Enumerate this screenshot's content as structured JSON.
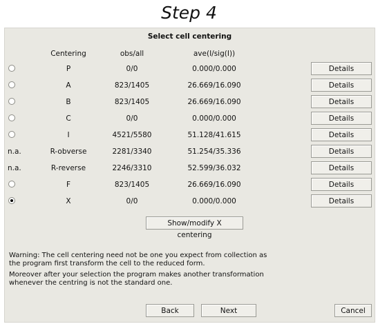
{
  "step_title": "Step 4",
  "panel_title": "Select cell centering",
  "headers": {
    "centering": "Centering",
    "obs_all": "obs/all",
    "ave": "ave(I/sig(I))"
  },
  "rows": [
    {
      "select": "radio",
      "checked": false,
      "label": "",
      "centering": "P",
      "obs_all": "0/0",
      "ave": "0.000/0.000",
      "button": "Details"
    },
    {
      "select": "radio",
      "checked": false,
      "label": "",
      "centering": "A",
      "obs_all": "823/1405",
      "ave": "26.669/16.090",
      "button": "Details"
    },
    {
      "select": "radio",
      "checked": false,
      "label": "",
      "centering": "B",
      "obs_all": "823/1405",
      "ave": "26.669/16.090",
      "button": "Details"
    },
    {
      "select": "radio",
      "checked": false,
      "label": "",
      "centering": "C",
      "obs_all": "0/0",
      "ave": "0.000/0.000",
      "button": "Details"
    },
    {
      "select": "radio",
      "checked": false,
      "label": "",
      "centering": "I",
      "obs_all": "4521/5580",
      "ave": "51.128/41.615",
      "button": "Details"
    },
    {
      "select": "text",
      "checked": false,
      "label": "n.a.",
      "centering": "R-obverse",
      "obs_all": "2281/3340",
      "ave": "51.254/35.336",
      "button": "Details"
    },
    {
      "select": "text",
      "checked": false,
      "label": "n.a.",
      "centering": "R-reverse",
      "obs_all": "2246/3310",
      "ave": "52.599/36.032",
      "button": "Details"
    },
    {
      "select": "radio",
      "checked": false,
      "label": "",
      "centering": "F",
      "obs_all": "823/1405",
      "ave": "26.669/16.090",
      "button": "Details"
    },
    {
      "select": "radio",
      "checked": true,
      "label": "",
      "centering": "X",
      "obs_all": "0/0",
      "ave": "0.000/0.000",
      "button": "Details"
    }
  ],
  "show_modify_button": "Show/modify X centering",
  "warning_line1": "Warning: The cell centering need not be one you expect from collection as",
  "warning_line2": "the program first transform the cell to the reduced form.",
  "note_line1": "Moreover after your selection the program makes another transformation",
  "note_line2": "whenever the centring is not the standard one.",
  "footer": {
    "back": "Back",
    "next": "Next",
    "cancel": "Cancel"
  }
}
